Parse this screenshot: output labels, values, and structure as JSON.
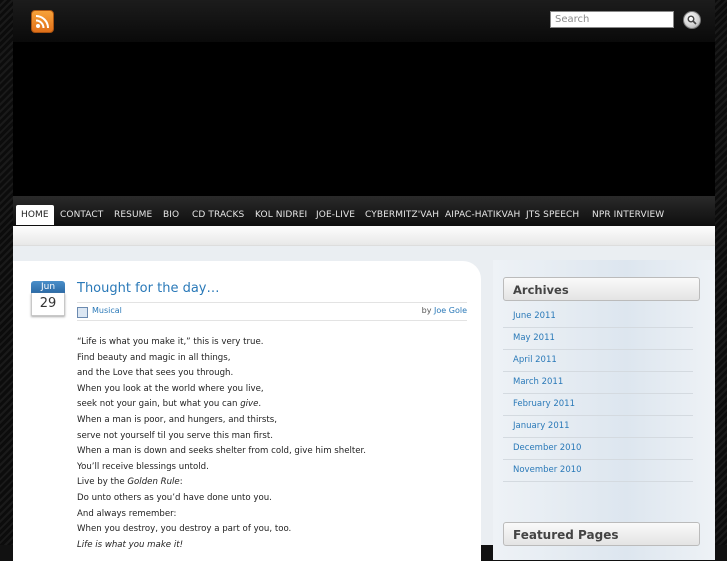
{
  "search": {
    "placeholder": "Search"
  },
  "nav": {
    "items": [
      "HOME",
      "CONTACT",
      "RESUME",
      "BIO",
      "CD TRACKS",
      "KOL NIDREI",
      "JOE-LIVE",
      "CYBERMITZ'VAH",
      "AIPAC-HATIKVAH",
      "JTS SPEECH",
      "NPR INTERVIEW"
    ]
  },
  "post": {
    "date_month": "Jun",
    "date_day": "29",
    "title": "Thought for the day…",
    "category": "Musical",
    "by_label": "by",
    "author": "Joe Gole",
    "lines": [
      "“Life is what you make it,” this is very true.",
      "Find beauty and magic in all things,",
      "and the Love that sees you through.",
      "When you look at the world where you live,",
      "seek not your gain, but what you can ",
      "give",
      ".",
      "When a man is poor, and hungers, and thirsts,",
      "serve not yourself til you serve this man first.",
      "When a man is down and seeks shelter from cold, give him shelter.",
      "You’ll receive blessings untold.",
      "Live by the ",
      "Golden Rule",
      ":",
      "Do unto others as you’d have done unto you.",
      "And always remember:",
      "When you destroy, you destroy a part of you, too.",
      "Life is what you make it!"
    ]
  },
  "sidebar": {
    "archives_title": "Archives",
    "archives": [
      "June 2011",
      "May 2011",
      "April 2011",
      "March 2011",
      "February 2011",
      "January 2011",
      "December 2010",
      "November 2010"
    ],
    "featured_title": "Featured Pages"
  }
}
